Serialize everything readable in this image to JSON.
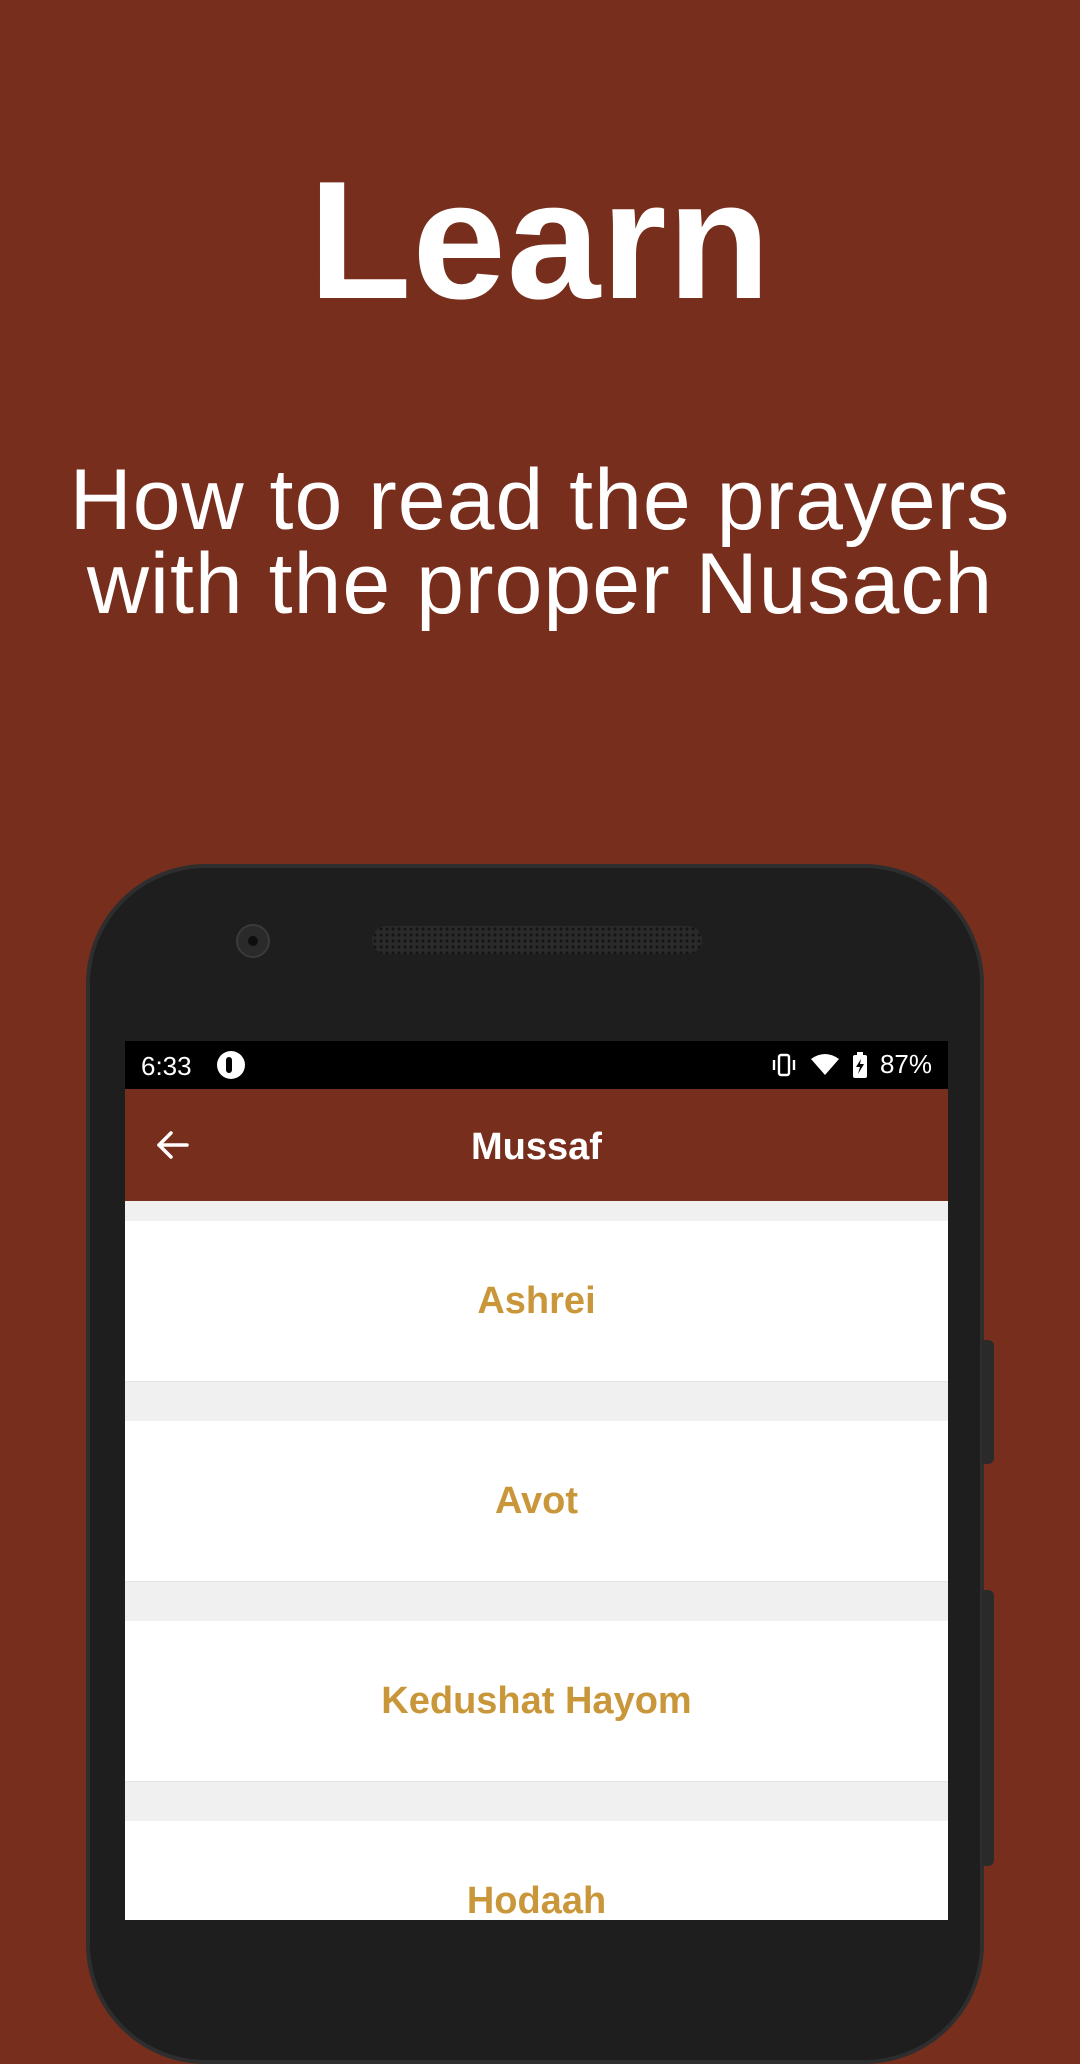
{
  "promo": {
    "headline": "Learn",
    "subhead_line1": "How to read the prayers",
    "subhead_line2": "with the proper Nusach"
  },
  "status_bar": {
    "time": "6:33",
    "battery": "87%",
    "icons": [
      "vibrate-icon",
      "wifi-icon",
      "battery-charging-icon"
    ]
  },
  "toolbar": {
    "title": "Mussaf",
    "back_icon": "arrow-left-icon"
  },
  "list": {
    "items": [
      {
        "label": "Ashrei"
      },
      {
        "label": "Avot"
      },
      {
        "label": "Kedushat Hayom"
      },
      {
        "label": "Hodaah"
      }
    ]
  },
  "colors": {
    "background": "#782E1D",
    "toolbar": "#782E1D",
    "item_text": "#C9973A",
    "list_background": "#F0F0F0"
  }
}
